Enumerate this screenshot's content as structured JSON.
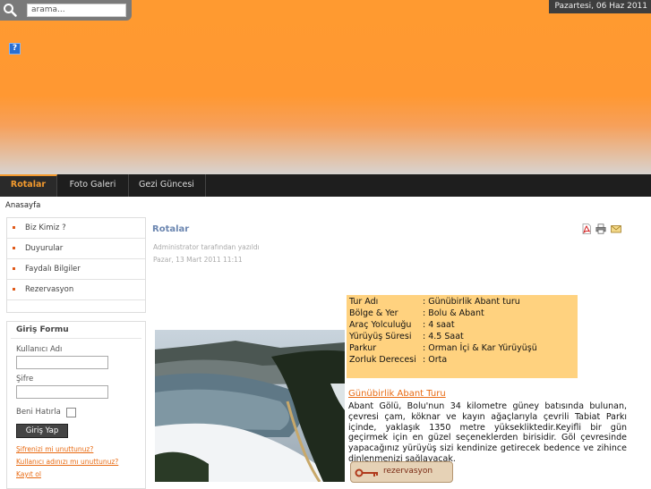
{
  "header": {
    "search_placeholder": "arama...",
    "date": "Pazartesi, 06 Haz 2011",
    "help_label": "?"
  },
  "nav": {
    "items": [
      {
        "label": "Rotalar"
      },
      {
        "label": "Foto Galeri"
      },
      {
        "label": "Gezi Güncesi"
      }
    ]
  },
  "breadcrumb": "Anasayfa",
  "sidebar": {
    "items": [
      {
        "label": "Biz Kimiz ?"
      },
      {
        "label": "Duyurular"
      },
      {
        "label": "Faydalı Bilgiler"
      },
      {
        "label": "Rezervasyon"
      }
    ]
  },
  "login": {
    "title": "Giriş Formu",
    "username_label": "Kullanıcı Adı",
    "password_label": "Şifre",
    "remember_label": "Beni Hatırla",
    "button": "Giriş Yap",
    "forgot_password": "Şifrenizi mi unuttunuz?",
    "forgot_username": "Kullanıcı adınızı mı unuttunuz?",
    "register": "Kayıt ol"
  },
  "article": {
    "title": "Rotalar",
    "author": "Administrator tarafından yazıldı",
    "date": "Pazar, 13 Mart 2011 11:11",
    "info": [
      {
        "key": "Tur Adı",
        "value": ": Günübirlik Abant turu"
      },
      {
        "key": "Bölge & Yer",
        "value": ": Bolu & Abant"
      },
      {
        "key": "Araç Yolculuğu",
        "value": ": 4 saat"
      },
      {
        "key": "Yürüyüş Süresi",
        "value": ": 4.5 Saat"
      },
      {
        "key": "Parkur",
        "value": ": Orman İçi & Kar Yürüyüşü"
      },
      {
        "key": "Zorluk Derecesi",
        "value": ": Orta"
      }
    ],
    "tour_link": "Günübirlik Abant Turu",
    "description": "Abant Gölü, Bolu'nun 34 kilometre güney batısında bulunan, çevresi çam, köknar ve kayın ağaçlarıyla çevrili Tabiat Parkı içinde, yaklaşık 1350 metre yüksekliktedir.Keyifli bir gün geçirmek için en güzel seçeneklerden birisidir. Göl çevresinde yapacağınız yürüyüş sizi kendinize getirecek bedence ve zihince dinlenmenizi sağlayacak.",
    "reservation_button": "rezervasyon"
  }
}
